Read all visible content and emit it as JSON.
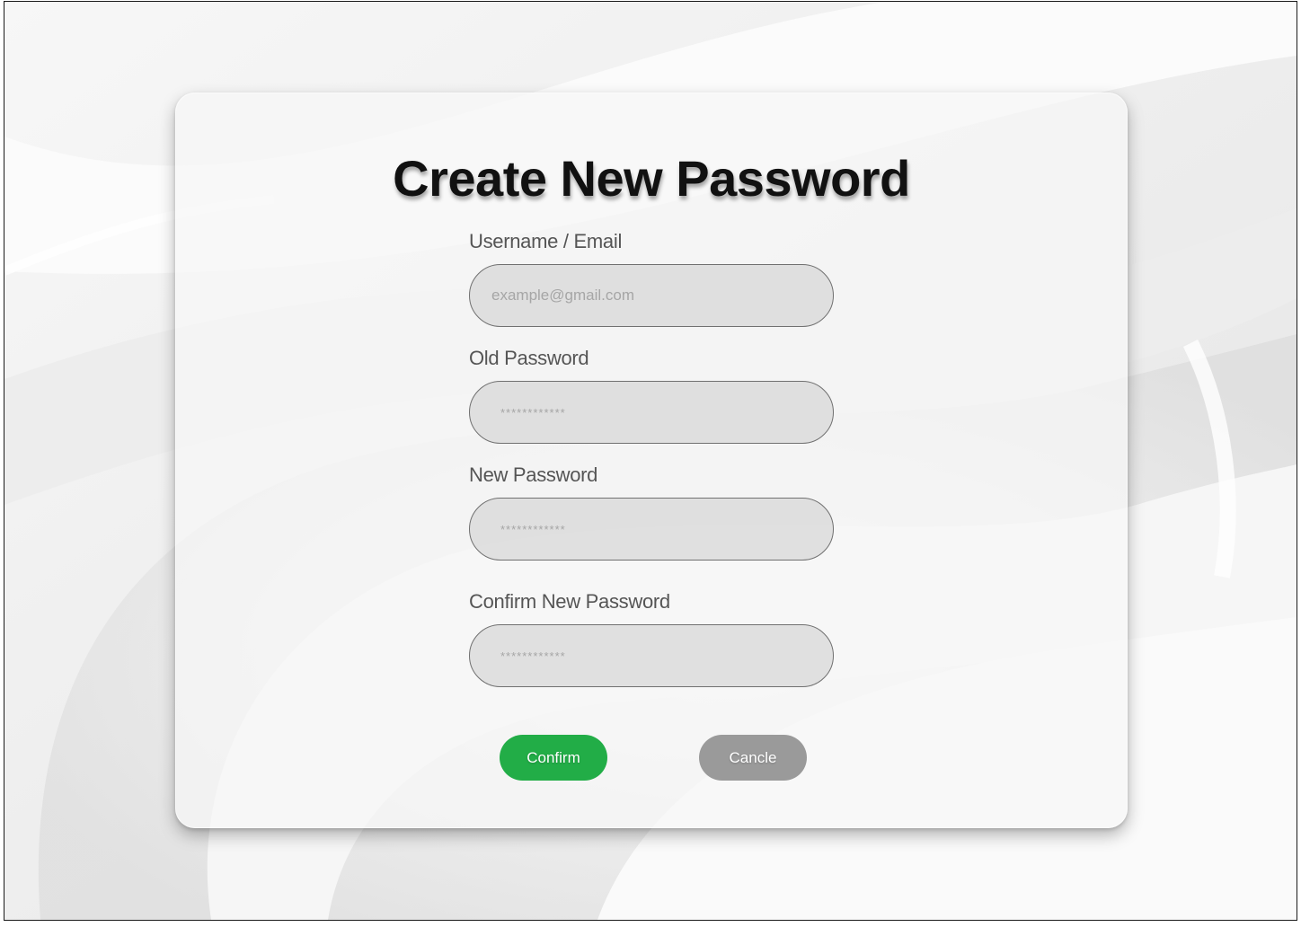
{
  "page": {
    "title": "Create New Password"
  },
  "form": {
    "username": {
      "label": "Username / Email",
      "placeholder": "example@gmail.com"
    },
    "old_password": {
      "label": "Old Password",
      "placeholder": "************"
    },
    "new_password": {
      "label": "New Password",
      "placeholder": "************"
    },
    "confirm_password": {
      "label": "Confirm New Password",
      "placeholder": "************"
    }
  },
  "actions": {
    "confirm_label": "Confirm",
    "cancel_label": "Cancle"
  },
  "colors": {
    "confirm": "#22ad47",
    "cancel": "#9a9a9a",
    "title": "#111111",
    "label": "#555555"
  }
}
